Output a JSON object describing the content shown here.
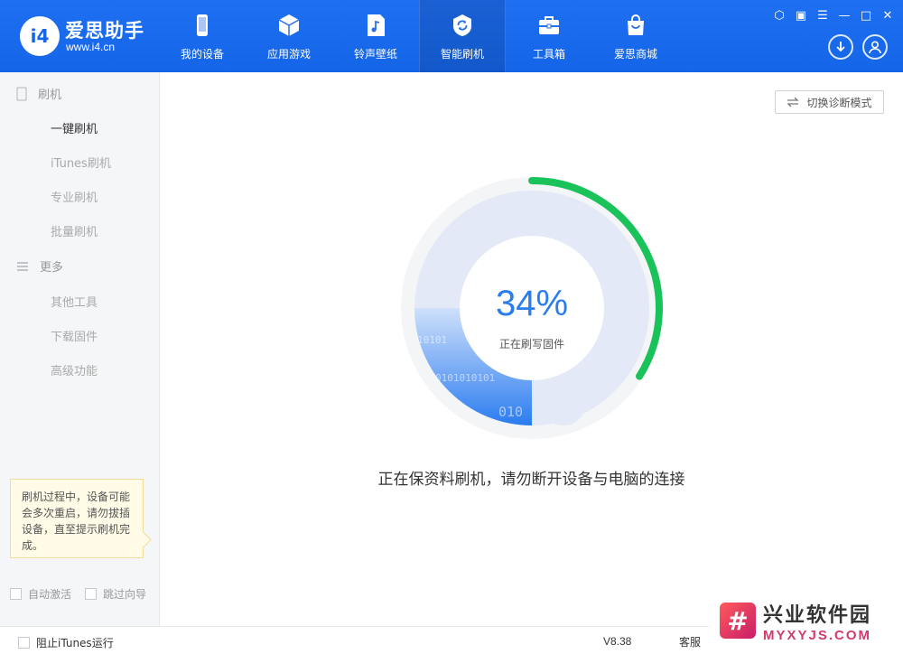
{
  "app": {
    "brand_name": "爱思助手",
    "brand_url": "www.i4.cn",
    "logo_text": "i4",
    "accent_color": "#1565e8"
  },
  "nav": {
    "items": [
      {
        "label": "我的设备",
        "icon": "phone-icon"
      },
      {
        "label": "应用游戏",
        "icon": "cube-icon"
      },
      {
        "label": "铃声壁纸",
        "icon": "music-file-icon"
      },
      {
        "label": "智能刷机",
        "icon": "refresh-shield-icon",
        "active": true
      },
      {
        "label": "工具箱",
        "icon": "toolbox-icon"
      },
      {
        "label": "爱思商城",
        "icon": "shopping-bag-icon"
      }
    ]
  },
  "window_controls": [
    "shirt-icon",
    "note-icon",
    "menu-icon",
    "minimize-icon",
    "maximize-icon",
    "close-icon"
  ],
  "sidebar": {
    "group_flash": "刷机",
    "items_flash": [
      "一键刷机",
      "iTunes刷机",
      "专业刷机",
      "批量刷机"
    ],
    "group_more": "更多",
    "items_more": [
      "其他工具",
      "下载固件",
      "高级功能"
    ],
    "active_item": "一键刷机",
    "tip": "刷机过程中，设备可能会多次重启，请勿拔插设备，直至提示刷机完成。",
    "auto_activate": "自动激活",
    "skip_guide": "跳过向导"
  },
  "main": {
    "switch_mode_label": "切换诊断模式",
    "progress_percent": 34,
    "progress_text": "34%",
    "progress_status": "正在刷写固件",
    "message": "正在保资料刷机，请勿断开设备与电脑的连接",
    "progress_color": "#19c35a",
    "binary_text": [
      "10101",
      "0101010101",
      "010"
    ]
  },
  "footer": {
    "block_itunes": "阻止iTunes运行",
    "version": "V8.38",
    "service": "客服"
  },
  "watermark": {
    "badge": "#",
    "name": "兴业软件园",
    "domain": "MYXYJS.COM"
  }
}
